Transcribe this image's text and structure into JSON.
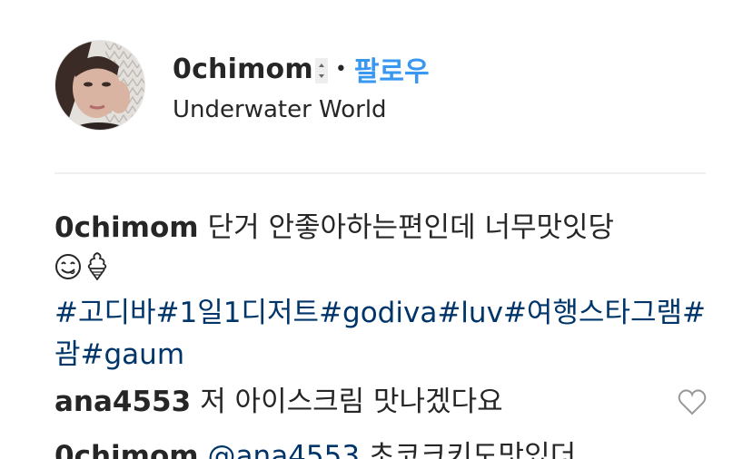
{
  "header": {
    "username": "0chimom",
    "separator": "•",
    "follow_label": "팔로우",
    "location": "Underwater World"
  },
  "caption": {
    "username": "0chimom",
    "text": "단거 안좋아하는편인데 너무맛잇당",
    "emojis": [
      "face-savoring-food-icon",
      "soft-ice-cream-icon"
    ],
    "hashtags": [
      "#고디바",
      "#1일1디저트",
      "#godiva",
      "#luv",
      "#여행스타그램",
      "#괌",
      "#gaum"
    ]
  },
  "comments": [
    {
      "username": "ana4553",
      "mention": "",
      "text": "저 아이스크림 맛나겠다요"
    },
    {
      "username": "0chimom",
      "mention": "@ana4553",
      "text": "초코크키도맛있더"
    }
  ],
  "colors": {
    "text": "#262626",
    "follow": "#3897f0",
    "hashtag": "#003569",
    "divider": "#efefef"
  }
}
